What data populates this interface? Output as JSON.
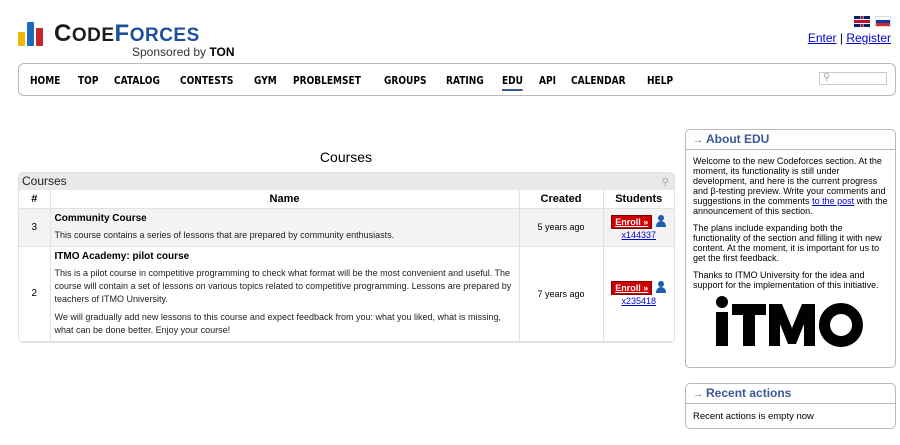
{
  "header": {
    "logo_main": "CODEFORCES",
    "logo_sub_prefix": "Sponsored by",
    "logo_sub_sponsor": "TON",
    "lang_flags": [
      "flag-uk-icon",
      "flag-ru-icon"
    ],
    "enter_label": "Enter",
    "separator": "|",
    "register_label": "Register"
  },
  "menu": {
    "items": [
      "HOME",
      "TOP",
      "CATALOG",
      "CONTESTS",
      "GYM",
      "PROBLEMSET",
      "GROUPS",
      "RATING",
      "EDU",
      "API",
      "CALENDAR",
      "HELP"
    ],
    "active": "EDU",
    "search_value": ""
  },
  "courses": {
    "title": "Courses",
    "table_caption": "Courses",
    "columns": [
      "#",
      "Name",
      "Created",
      "Students"
    ],
    "rows": [
      {
        "num": "3",
        "name": "Community Course",
        "desc": [
          "This course contains a series of lessons that are prepared by community enthusiasts."
        ],
        "created": "5 years ago",
        "enroll": "Enroll »",
        "students": "x144337"
      },
      {
        "num": "2",
        "name": "ITMO Academy: pilot course",
        "desc": [
          "This is a pilot course in competitive programming to check what format will be the most convenient and useful. The course will contain a set of lessons on various topics related to competitive programming. Lessons are prepared by teachers of ITMO University.",
          "We will gradually add new lessons to this course and expect feedback from you: what you liked, what is missing, what can be done better. Enjoy your course!"
        ],
        "created": "7 years ago",
        "enroll": "Enroll »",
        "students": "x235418"
      }
    ]
  },
  "sidebar": {
    "about": {
      "title": "About EDU",
      "p1_before": "Welcome to the new Codeforces section. At the moment, its functionality is still under development, and here is the current progress and β-testing preview. Write your comments and suggestions in the comments ",
      "p1_link": "to the post",
      "p1_after": " with the announcement of this section.",
      "p2": "The plans include expanding both the functionality of the section and filling it with new content. At the moment, it is important for us to get the first feedback.",
      "p3": "Thanks to ITMO University for the idea and support for the implementation of this initiative.",
      "logo_text": "iTMO"
    },
    "recent": {
      "title": "Recent actions",
      "body": "Recent actions is empty now"
    }
  },
  "colors": {
    "brand_blue": "#1c4f9c",
    "logo_bar_yellow": "#f2b705",
    "logo_bar_blue": "#1a6bb8",
    "logo_bar_red": "#c1272d",
    "enroll_red": "#cc0000",
    "sidebar_title": "#3b5998"
  }
}
